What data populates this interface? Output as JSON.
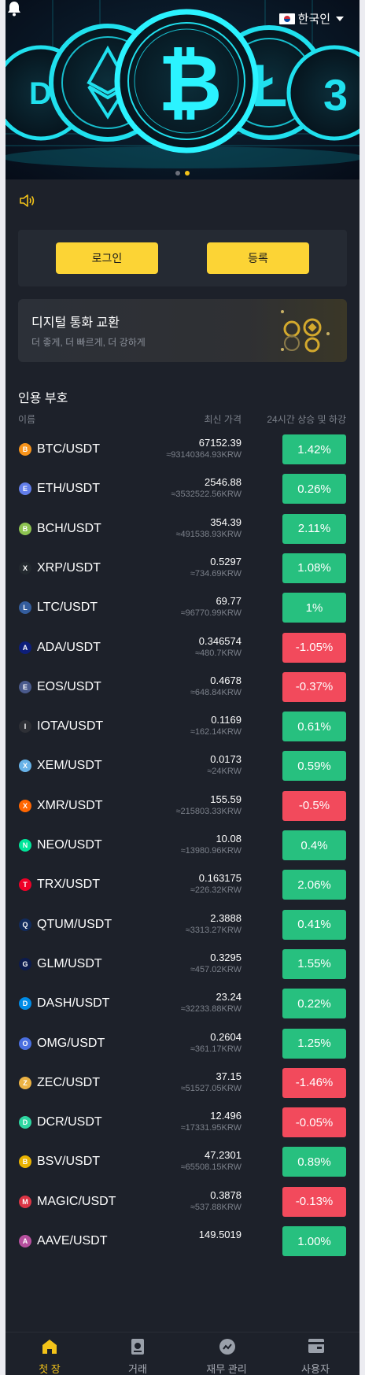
{
  "header": {
    "language": "한국인"
  },
  "auth": {
    "login_label": "로그인",
    "register_label": "등록"
  },
  "promo": {
    "title": "디지털 통화 교환",
    "subtitle": "더 좋게, 더 빠르게, 더 강하게"
  },
  "market": {
    "title": "인용 부호",
    "columns": {
      "name": "이름",
      "price": "최신 가격",
      "change": "24시간 상승 및 하강"
    },
    "rows": [
      {
        "pair": "BTC/USDT",
        "price": "67152.39",
        "krw": "≈93140364.93KRW",
        "change": "1.42%",
        "dir": "up",
        "icon_color": "#f7931a",
        "icon": "btc-icon"
      },
      {
        "pair": "ETH/USDT",
        "price": "2546.88",
        "krw": "≈3532522.56KRW",
        "change": "0.26%",
        "dir": "up",
        "icon_color": "#627eea",
        "icon": "eth-icon"
      },
      {
        "pair": "BCH/USDT",
        "price": "354.39",
        "krw": "≈491538.93KRW",
        "change": "2.11%",
        "dir": "up",
        "icon_color": "#8dc351",
        "icon": "bch-icon"
      },
      {
        "pair": "XRP/USDT",
        "price": "0.5297",
        "krw": "≈734.69KRW",
        "change": "1.08%",
        "dir": "up",
        "icon_color": "#23292f",
        "icon": "xrp-icon"
      },
      {
        "pair": "LTC/USDT",
        "price": "69.77",
        "krw": "≈96770.99KRW",
        "change": "1%",
        "dir": "up",
        "icon_color": "#345d9d",
        "icon": "ltc-icon"
      },
      {
        "pair": "ADA/USDT",
        "price": "0.346574",
        "krw": "≈480.7KRW",
        "change": "-1.05%",
        "dir": "down",
        "icon_color": "#0d1e7a",
        "icon": "ada-icon"
      },
      {
        "pair": "EOS/USDT",
        "price": "0.4678",
        "krw": "≈648.84KRW",
        "change": "-0.37%",
        "dir": "down",
        "icon_color": "#4a5a8c",
        "icon": "eos-icon"
      },
      {
        "pair": "IOTA/USDT",
        "price": "0.1169",
        "krw": "≈162.14KRW",
        "change": "0.61%",
        "dir": "up",
        "icon_color": "#2e3036",
        "icon": "iota-icon"
      },
      {
        "pair": "XEM/USDT",
        "price": "0.0173",
        "krw": "≈24KRW",
        "change": "0.59%",
        "dir": "up",
        "icon_color": "#67b2e8",
        "icon": "xem-icon"
      },
      {
        "pair": "XMR/USDT",
        "price": "155.59",
        "krw": "≈215803.33KRW",
        "change": "-0.5%",
        "dir": "down",
        "icon_color": "#ff6600",
        "icon": "xmr-icon"
      },
      {
        "pair": "NEO/USDT",
        "price": "10.08",
        "krw": "≈13980.96KRW",
        "change": "0.4%",
        "dir": "up",
        "icon_color": "#00e599",
        "icon": "neo-icon"
      },
      {
        "pair": "TRX/USDT",
        "price": "0.163175",
        "krw": "≈226.32KRW",
        "change": "2.06%",
        "dir": "up",
        "icon_color": "#ef0027",
        "icon": "trx-icon"
      },
      {
        "pair": "QTUM/USDT",
        "price": "2.3888",
        "krw": "≈3313.27KRW",
        "change": "0.41%",
        "dir": "up",
        "icon_color": "#122b5c",
        "icon": "qtum-icon"
      },
      {
        "pair": "GLM/USDT",
        "price": "0.3295",
        "krw": "≈457.02KRW",
        "change": "1.55%",
        "dir": "up",
        "icon_color": "#0c1b4d",
        "icon": "glm-icon"
      },
      {
        "pair": "DASH/USDT",
        "price": "23.24",
        "krw": "≈32233.88KRW",
        "change": "0.22%",
        "dir": "up",
        "icon_color": "#008ce7",
        "icon": "dash-icon"
      },
      {
        "pair": "OMG/USDT",
        "price": "0.2604",
        "krw": "≈361.17KRW",
        "change": "1.25%",
        "dir": "up",
        "icon_color": "#4a6fe0",
        "icon": "omg-icon"
      },
      {
        "pair": "ZEC/USDT",
        "price": "37.15",
        "krw": "≈51527.05KRW",
        "change": "-1.46%",
        "dir": "down",
        "icon_color": "#ecb244",
        "icon": "zec-icon"
      },
      {
        "pair": "DCR/USDT",
        "price": "12.496",
        "krw": "≈17331.95KRW",
        "change": "-0.05%",
        "dir": "down",
        "icon_color": "#2ed6a1",
        "icon": "dcr-icon"
      },
      {
        "pair": "BSV/USDT",
        "price": "47.2301",
        "krw": "≈65508.15KRW",
        "change": "0.89%",
        "dir": "up",
        "icon_color": "#eab300",
        "icon": "bsv-icon"
      },
      {
        "pair": "MAGIC/USDT",
        "price": "0.3878",
        "krw": "≈537.88KRW",
        "change": "-0.13%",
        "dir": "down",
        "icon_color": "#dc3545",
        "icon": "magic-icon"
      },
      {
        "pair": "AAVE/USDT",
        "price": "149.5019",
        "krw": "",
        "change": "1.00%",
        "dir": "up",
        "icon_color": "#b6509e",
        "icon": "aave-icon"
      }
    ]
  },
  "nav": {
    "items": [
      {
        "label": "첫 장",
        "icon": "home-icon",
        "active": true
      },
      {
        "label": "거래",
        "icon": "trade-icon",
        "active": false
      },
      {
        "label": "재무 관리",
        "icon": "finance-icon",
        "active": false
      },
      {
        "label": "사용자",
        "icon": "user-icon",
        "active": false
      }
    ]
  },
  "colors": {
    "accent": "#fcd435",
    "up": "#27c07f",
    "down": "#f24a5c",
    "background": "#1d212a"
  }
}
